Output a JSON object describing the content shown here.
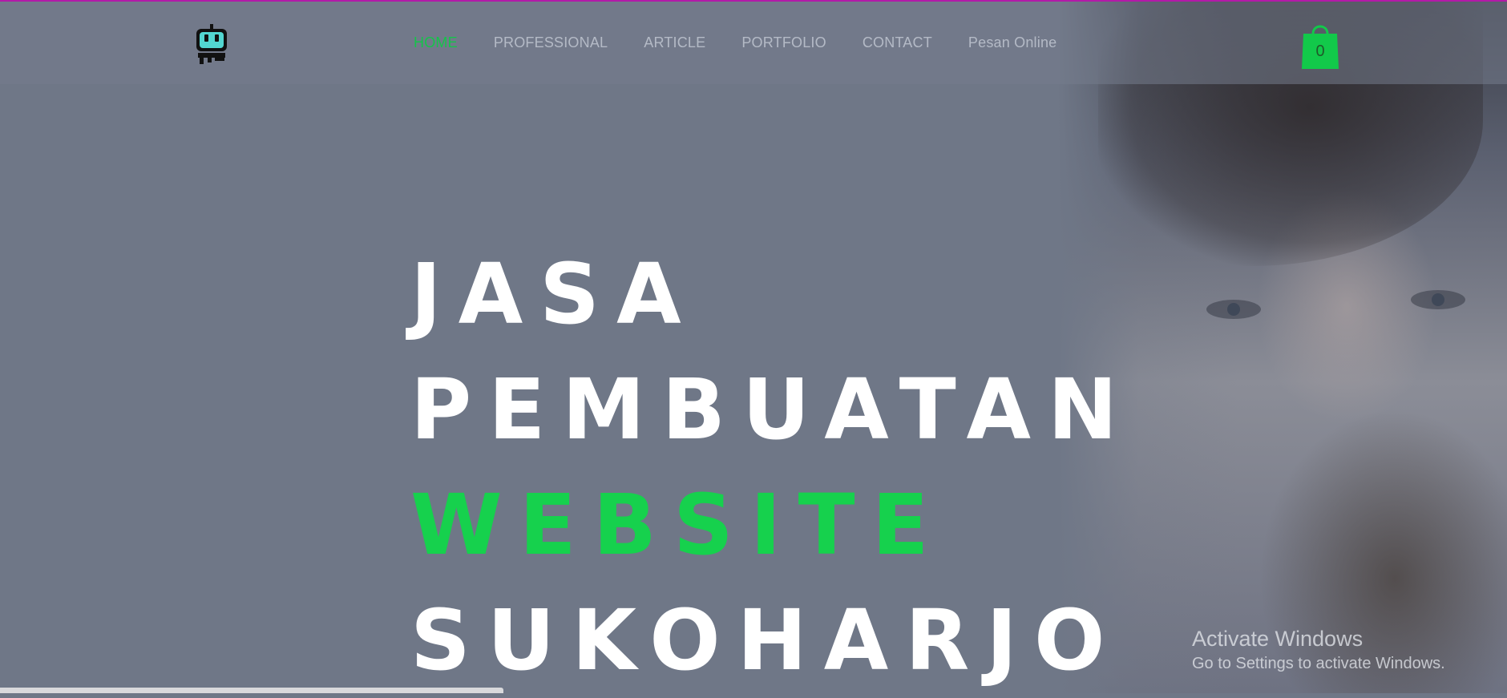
{
  "colors": {
    "accent": "#16d14d",
    "background": "#6f7787",
    "top_border": "#b31aa8",
    "cart": "#12c94a"
  },
  "header": {
    "logo_icon": "robot-logo-icon",
    "nav": [
      {
        "label": "HOME",
        "active": true
      },
      {
        "label": "PROFESSIONAL",
        "active": false
      },
      {
        "label": "ARTICLE",
        "active": false
      },
      {
        "label": "PORTFOLIO",
        "active": false
      },
      {
        "label": "CONTACT",
        "active": false
      },
      {
        "label": "Pesan Online",
        "active": false
      }
    ],
    "cart": {
      "icon": "shopping-bag-icon",
      "count": "0"
    }
  },
  "hero": {
    "lines": [
      "JASA",
      "PEMBUATAN",
      "WEBSITE",
      "SUKOHARJO"
    ],
    "highlight_line": "WEBSITE"
  },
  "watermark": {
    "title": "Activate Windows",
    "subtitle": "Go to Settings to activate Windows."
  }
}
